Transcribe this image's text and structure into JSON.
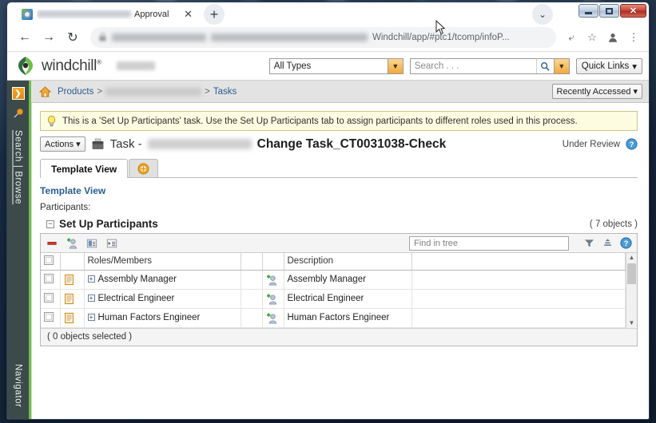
{
  "browser": {
    "tab": {
      "title": "Approval",
      "favicon_name": "windchill-favicon",
      "close_label": "✕"
    },
    "newtab_label": "+",
    "tab_list_label": "⌄",
    "nav": {
      "back": "←",
      "forward": "→",
      "reload": "↻"
    },
    "url_text": "Windchill/app/#ptc1/tcomp/infoP...",
    "omnibox_icons": [
      "share-icon",
      "bookmark-star-icon",
      "profile-icon",
      "menu-kebab-icon"
    ],
    "window_buttons": {
      "minimize": "–",
      "maximize": "□",
      "close": "✕"
    }
  },
  "header": {
    "brand": "windchill",
    "brand_tm": "®",
    "type_filter": {
      "value": "All Types",
      "caret": "▼"
    },
    "search": {
      "placeholder": "Search . . .",
      "go_icon": "magnifier-icon",
      "caret": "▼"
    },
    "quick_links": {
      "label": "Quick Links",
      "caret": "▾"
    }
  },
  "rail": {
    "expand_icon": "expand-panel-icon",
    "pin_icon": "pin-icon",
    "search_browse": "Search | Browse",
    "navigator": "Navigator"
  },
  "breadcrumb": {
    "home_icon": "home-icon",
    "items": [
      "Products",
      "Tasks"
    ],
    "separator": ">",
    "recently_accessed": {
      "label": "Recently Accessed",
      "caret": "▾"
    }
  },
  "notice": {
    "icon": "lightbulb-icon",
    "text": "This is a 'Set Up Participants' task. Use the Set Up Participants tab to assign participants to different roles used in this process."
  },
  "task": {
    "actions_label": "Actions",
    "actions_caret": "▾",
    "task_icon": "task-briefcase-icon",
    "prefix": "Task -",
    "title": "Change Task_CT0031038-Check",
    "status": "Under Review",
    "help_icon": "help-icon"
  },
  "tabs": [
    {
      "label": "Template View",
      "active": true
    },
    {
      "label": "",
      "icon": "add-circle-icon",
      "active": false
    }
  ],
  "panel": {
    "template_view_link": "Template View",
    "participants_label": "Participants:",
    "section_title": "Set Up Participants",
    "collapse_glyph": "−",
    "object_count": "( 7 objects )"
  },
  "toolbar": {
    "remove_icon": "remove-minus-icon",
    "add_participant_icon": "add-participant-icon",
    "collapse_all_icon": "collapse-tree-icon",
    "expand_all_icon": "expand-tree-icon",
    "find_placeholder": "Find in tree",
    "filter_icon": "filter-icon",
    "level_icon": "tree-level-icon",
    "help_icon": "help-icon"
  },
  "table": {
    "columns": [
      "",
      "",
      "Roles/Members",
      "",
      "",
      "Description",
      ""
    ],
    "rows": [
      {
        "role": "Assembly Manager",
        "description": "Assembly Manager",
        "row_icon": "role-scroll-icon",
        "expander": "+",
        "member_icon": "add-participant-icon"
      },
      {
        "role": "Electrical Engineer",
        "description": "Electrical Engineer",
        "row_icon": "role-scroll-icon",
        "expander": "+",
        "member_icon": "add-participant-icon"
      },
      {
        "role": "Human Factors Engineer",
        "description": "Human Factors Engineer",
        "row_icon": "role-scroll-icon",
        "expander": "+",
        "member_icon": "add-participant-icon"
      }
    ],
    "selection_status": "( 0 objects selected )",
    "scroll_up": "▲",
    "scroll_down": "▼"
  },
  "colors": {
    "windchill_green": "#6ebe4a",
    "accent_orange": "#f0a93a",
    "link_blue": "#2a5d8f",
    "notice_bg": "#fdfbe0",
    "rail_bg": "#3c4a4a"
  }
}
